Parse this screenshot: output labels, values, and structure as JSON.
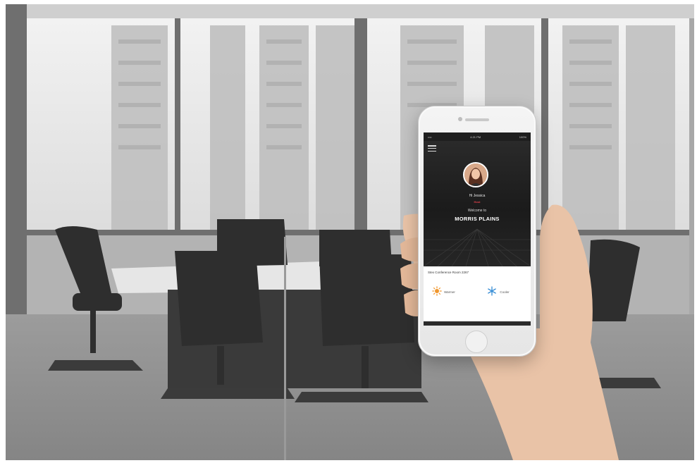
{
  "statusbar": {
    "carrier": "•••• ",
    "time": "4:21 PM",
    "battery": "100%"
  },
  "app": {
    "menu_icon": "hamburger-menu-icon",
    "user": {
      "name": "Hi Jessica",
      "tag": "Host"
    },
    "welcome_text": "Welcome to",
    "site_name": "MORRIS PLAINS",
    "room_label": "Stex Conference Room 2267",
    "actions": [
      {
        "label": "Warmer",
        "icon": "sun-icon",
        "color": "#f0962c"
      },
      {
        "label": "Cooler",
        "icon": "snowflake-icon",
        "color": "#3a8fd6"
      }
    ]
  },
  "colors": {
    "accent_warm": "#f0962c",
    "accent_cool": "#3a8fd6",
    "tag_red": "#e0404a"
  }
}
